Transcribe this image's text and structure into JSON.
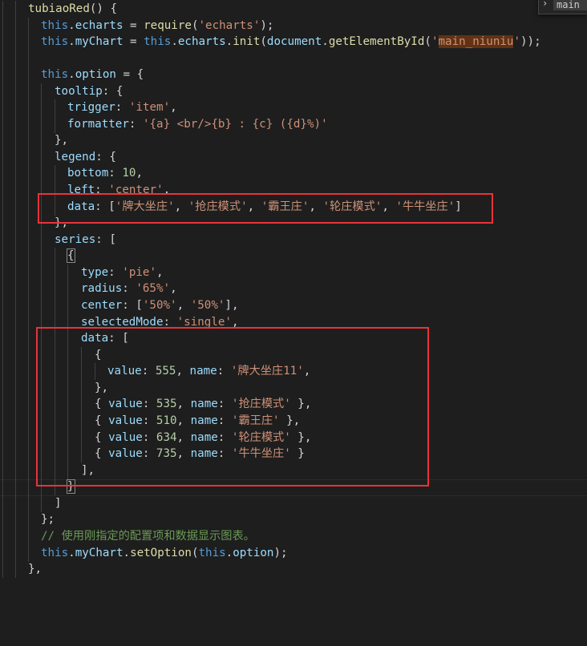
{
  "find_widget": {
    "chevron_icon": "›",
    "query": "main"
  },
  "code": {
    "method_name": "tubiaoRed",
    "require_module": "echarts",
    "element_id": "main_niuniu",
    "tooltip": {
      "trigger": "item",
      "formatter": "{a} <br/>{b} : {c} ({d}%)"
    },
    "legend": {
      "bottom": "10",
      "left": "center",
      "data": [
        "牌大坐庄",
        "抢庄模式",
        "霸王庄",
        "轮庄模式",
        "牛牛坐庄"
      ]
    },
    "series": {
      "type": "pie",
      "radius": "65%",
      "center": [
        "50%",
        "50%"
      ],
      "selectedMode": "single",
      "data": [
        {
          "value": "555",
          "name": "牌大坐庄11"
        },
        {
          "value": "535",
          "name": "抢庄模式"
        },
        {
          "value": "510",
          "name": "霸王庄"
        },
        {
          "value": "634",
          "name": "轮庄模式"
        },
        {
          "value": "735",
          "name": "牛牛坐庄"
        }
      ]
    },
    "comment": "// 使用刚指定的配置项和数据显示图表。"
  }
}
